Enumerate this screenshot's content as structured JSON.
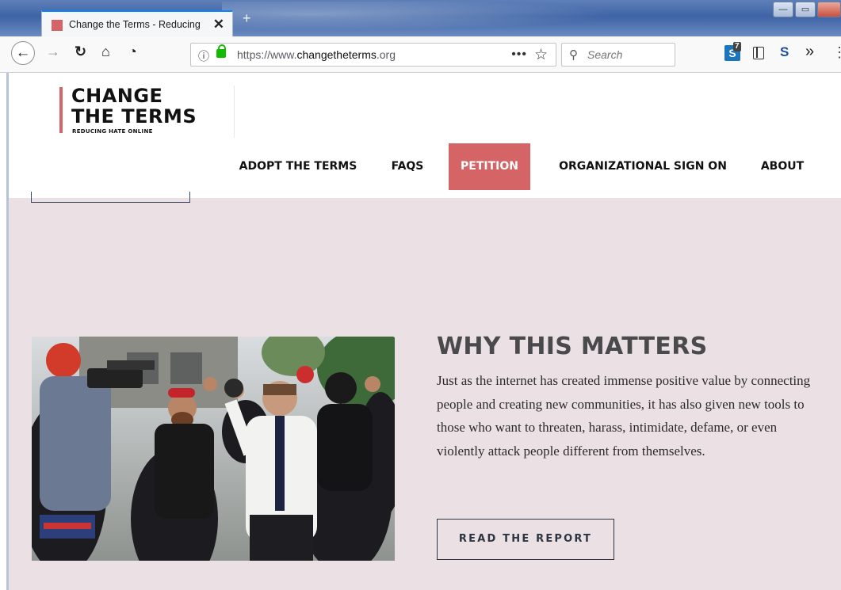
{
  "browser": {
    "tab_title": "Change the Terms - Reducing Hate Online",
    "tab_close": "✕",
    "new_tab": "+",
    "url_prefix": "https://www.",
    "url_host": "changetheterms",
    "url_suffix": ".org",
    "page_actions": "•••",
    "bookmark_star": "☆",
    "search_placeholder": "Search",
    "ext_badge": "7",
    "ext_letter": "S",
    "s_letter": "S",
    "overflow": "»",
    "window_buttons": {
      "minimize": "—",
      "maximize": "▭"
    }
  },
  "site": {
    "logo": {
      "line1": "CHANGE",
      "line2": "THE TERMS",
      "tagline": "REDUCING HATE ONLINE"
    },
    "nav": [
      {
        "label": "ADOPT THE TERMS"
      },
      {
        "label": "FAQS"
      },
      {
        "label": "PETITION",
        "active": true
      },
      {
        "label": "ORGANIZATIONAL SIGN ON"
      },
      {
        "label": "ABOUT"
      }
    ]
  },
  "section": {
    "title": "WHY THIS MATTERS",
    "body": "Just as the internet has created immense positive value by connecting people and creating new communities, it has also given new tools to those who want to threaten, harass, intimidate, defame, or even violently attack people different from themselves.",
    "cta": "READ THE REPORT"
  },
  "colors": {
    "accent": "#d46465",
    "hero_bg": "#ebe1e5",
    "title": "#4a4a4d"
  }
}
